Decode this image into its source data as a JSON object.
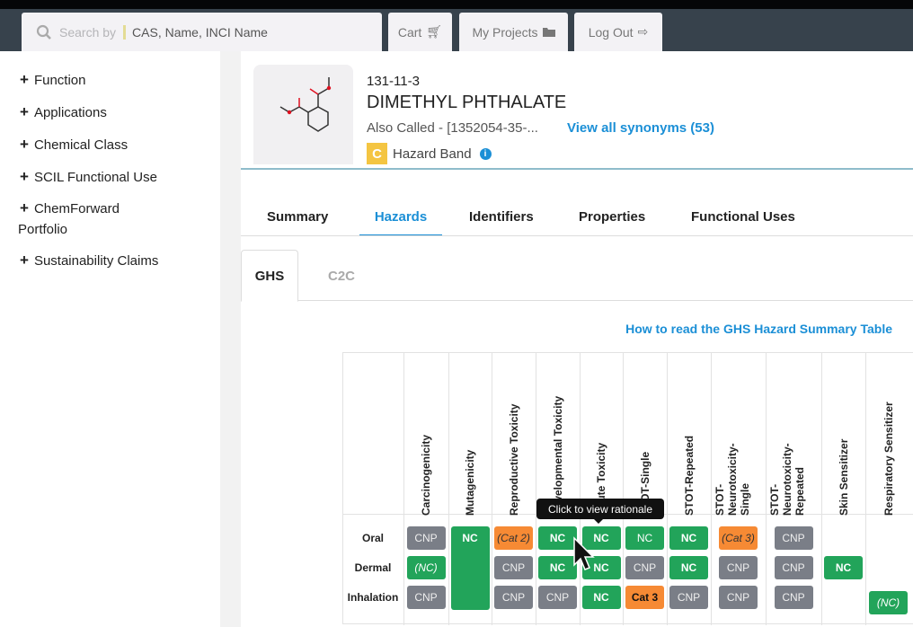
{
  "nav": {
    "search_placeholder": "Search by",
    "search_value": "CAS, Name, INCI Name",
    "cart": "Cart",
    "projects": "My Projects",
    "logout": "Log Out"
  },
  "sidebar": {
    "items": [
      {
        "label": "Function"
      },
      {
        "label": "Applications"
      },
      {
        "label": "Chemical Class"
      },
      {
        "label": "SCIL Functional Use"
      },
      {
        "label": "ChemForward Portfolio"
      },
      {
        "label": "Sustainability Claims"
      }
    ]
  },
  "chemical": {
    "cas": "131-11-3",
    "name": "DIMETHYL PHTHALATE",
    "also_called": "Also Called - [1352054-35-...",
    "synonyms_link": "View all synonyms (53)",
    "band": "C",
    "band_label": "Hazard Band",
    "band_color": "#f4c542"
  },
  "tabs": [
    "Summary",
    "Hazards",
    "Identifiers",
    "Properties",
    "Functional Uses"
  ],
  "active_tab": "Hazards",
  "subtabs": [
    "GHS",
    "C2C"
  ],
  "howto_link": "How to read the GHS Hazard Summary Table",
  "tooltip": "Click to view rationale",
  "table": {
    "columns": [
      "Carcinogenicity",
      "Mutagenicity",
      "Reproductive Toxicity",
      "Developmental Toxicity",
      "Acute Toxicity",
      "STOT-Single",
      "STOT-Repeated",
      "STOT- Neurotoxicity- Single",
      "STOT- Neurotoxicity- Repeated",
      "Skin Sensitizer",
      "Respiratory Sensitizer"
    ],
    "rows": [
      "Oral",
      "Dermal",
      "Inhalation"
    ],
    "cells": {
      "oral": [
        "CNP",
        "NC",
        "(Cat 2)",
        "NC",
        "NC",
        "NC",
        "NC",
        "(Cat 3)",
        "CNP",
        "",
        ""
      ],
      "dermal": [
        "(NC)",
        "",
        "CNP",
        "NC",
        "NC",
        "CNP",
        "NC",
        "CNP",
        "CNP",
        "NC",
        ""
      ],
      "inhalation": [
        "CNP",
        "",
        "CNP",
        "CNP",
        "NC",
        "Cat 3",
        "CNP",
        "CNP",
        "CNP",
        "",
        "(NC)"
      ]
    },
    "colors": {
      "cnp": "#7a7e87",
      "nc": "#22a45a",
      "cat": "#f68a34"
    }
  }
}
